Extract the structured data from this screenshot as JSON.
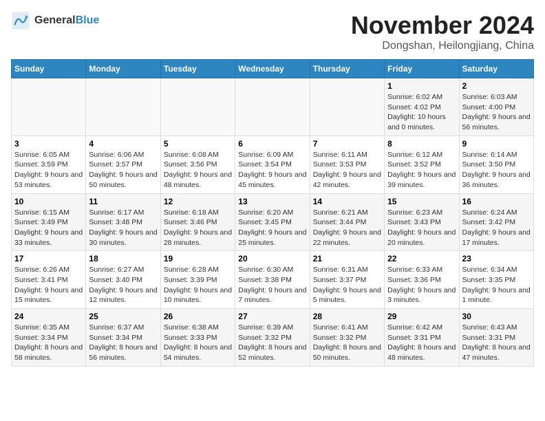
{
  "header": {
    "logo_line1": "General",
    "logo_line2": "Blue",
    "main_title": "November 2024",
    "subtitle": "Dongshan, Heilongjiang, China"
  },
  "weekdays": [
    "Sunday",
    "Monday",
    "Tuesday",
    "Wednesday",
    "Thursday",
    "Friday",
    "Saturday"
  ],
  "weeks": [
    [
      {
        "day": "",
        "info": ""
      },
      {
        "day": "",
        "info": ""
      },
      {
        "day": "",
        "info": ""
      },
      {
        "day": "",
        "info": ""
      },
      {
        "day": "",
        "info": ""
      },
      {
        "day": "1",
        "info": "Sunrise: 6:02 AM\nSunset: 4:02 PM\nDaylight: 10 hours and 0 minutes."
      },
      {
        "day": "2",
        "info": "Sunrise: 6:03 AM\nSunset: 4:00 PM\nDaylight: 9 hours and 56 minutes."
      }
    ],
    [
      {
        "day": "3",
        "info": "Sunrise: 6:05 AM\nSunset: 3:59 PM\nDaylight: 9 hours and 53 minutes."
      },
      {
        "day": "4",
        "info": "Sunrise: 6:06 AM\nSunset: 3:57 PM\nDaylight: 9 hours and 50 minutes."
      },
      {
        "day": "5",
        "info": "Sunrise: 6:08 AM\nSunset: 3:56 PM\nDaylight: 9 hours and 48 minutes."
      },
      {
        "day": "6",
        "info": "Sunrise: 6:09 AM\nSunset: 3:54 PM\nDaylight: 9 hours and 45 minutes."
      },
      {
        "day": "7",
        "info": "Sunrise: 6:11 AM\nSunset: 3:53 PM\nDaylight: 9 hours and 42 minutes."
      },
      {
        "day": "8",
        "info": "Sunrise: 6:12 AM\nSunset: 3:52 PM\nDaylight: 9 hours and 39 minutes."
      },
      {
        "day": "9",
        "info": "Sunrise: 6:14 AM\nSunset: 3:50 PM\nDaylight: 9 hours and 36 minutes."
      }
    ],
    [
      {
        "day": "10",
        "info": "Sunrise: 6:15 AM\nSunset: 3:49 PM\nDaylight: 9 hours and 33 minutes."
      },
      {
        "day": "11",
        "info": "Sunrise: 6:17 AM\nSunset: 3:48 PM\nDaylight: 9 hours and 30 minutes."
      },
      {
        "day": "12",
        "info": "Sunrise: 6:18 AM\nSunset: 3:46 PM\nDaylight: 9 hours and 28 minutes."
      },
      {
        "day": "13",
        "info": "Sunrise: 6:20 AM\nSunset: 3:45 PM\nDaylight: 9 hours and 25 minutes."
      },
      {
        "day": "14",
        "info": "Sunrise: 6:21 AM\nSunset: 3:44 PM\nDaylight: 9 hours and 22 minutes."
      },
      {
        "day": "15",
        "info": "Sunrise: 6:23 AM\nSunset: 3:43 PM\nDaylight: 9 hours and 20 minutes."
      },
      {
        "day": "16",
        "info": "Sunrise: 6:24 AM\nSunset: 3:42 PM\nDaylight: 9 hours and 17 minutes."
      }
    ],
    [
      {
        "day": "17",
        "info": "Sunrise: 6:26 AM\nSunset: 3:41 PM\nDaylight: 9 hours and 15 minutes."
      },
      {
        "day": "18",
        "info": "Sunrise: 6:27 AM\nSunset: 3:40 PM\nDaylight: 9 hours and 12 minutes."
      },
      {
        "day": "19",
        "info": "Sunrise: 6:28 AM\nSunset: 3:39 PM\nDaylight: 9 hours and 10 minutes."
      },
      {
        "day": "20",
        "info": "Sunrise: 6:30 AM\nSunset: 3:38 PM\nDaylight: 9 hours and 7 minutes."
      },
      {
        "day": "21",
        "info": "Sunrise: 6:31 AM\nSunset: 3:37 PM\nDaylight: 9 hours and 5 minutes."
      },
      {
        "day": "22",
        "info": "Sunrise: 6:33 AM\nSunset: 3:36 PM\nDaylight: 9 hours and 3 minutes."
      },
      {
        "day": "23",
        "info": "Sunrise: 6:34 AM\nSunset: 3:35 PM\nDaylight: 9 hours and 1 minute."
      }
    ],
    [
      {
        "day": "24",
        "info": "Sunrise: 6:35 AM\nSunset: 3:34 PM\nDaylight: 8 hours and 58 minutes."
      },
      {
        "day": "25",
        "info": "Sunrise: 6:37 AM\nSunset: 3:34 PM\nDaylight: 8 hours and 56 minutes."
      },
      {
        "day": "26",
        "info": "Sunrise: 6:38 AM\nSunset: 3:33 PM\nDaylight: 8 hours and 54 minutes."
      },
      {
        "day": "27",
        "info": "Sunrise: 6:39 AM\nSunset: 3:32 PM\nDaylight: 8 hours and 52 minutes."
      },
      {
        "day": "28",
        "info": "Sunrise: 6:41 AM\nSunset: 3:32 PM\nDaylight: 8 hours and 50 minutes."
      },
      {
        "day": "29",
        "info": "Sunrise: 6:42 AM\nSunset: 3:31 PM\nDaylight: 8 hours and 48 minutes."
      },
      {
        "day": "30",
        "info": "Sunrise: 6:43 AM\nSunset: 3:31 PM\nDaylight: 8 hours and 47 minutes."
      }
    ]
  ]
}
